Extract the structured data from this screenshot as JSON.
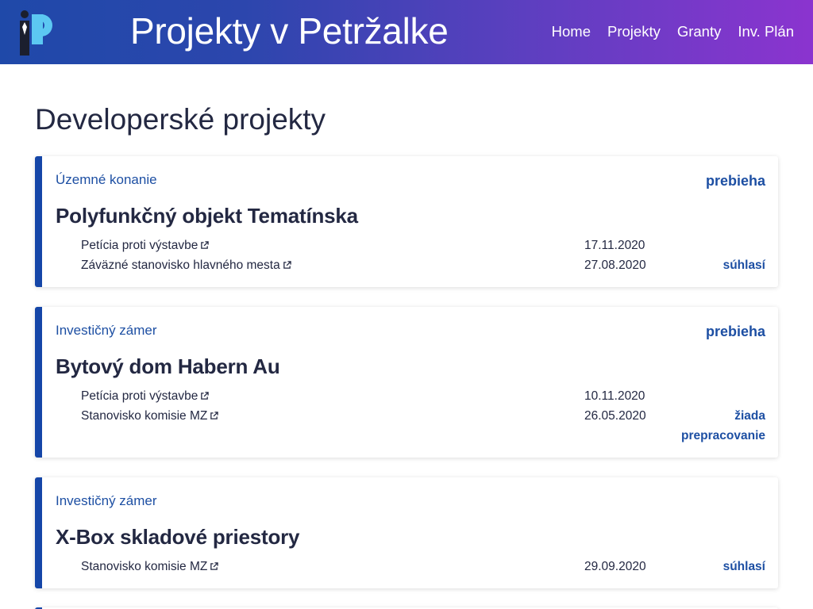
{
  "header": {
    "title": "Projekty v Petržalke",
    "nav": [
      "Home",
      "Projekty",
      "Granty",
      "Inv. Plán"
    ]
  },
  "page_title": "Developerské projekty",
  "colors": {
    "accent": "#1d4fa3",
    "card_border": "#1546a8",
    "header_start": "#1f49a9",
    "header_end": "#8b34cf"
  },
  "projects": [
    {
      "category": "Územné konanie",
      "state": "prebieha",
      "name": "Polyfunkčný objekt Tematínska",
      "docs": [
        {
          "label": "Petícia proti výstavbe",
          "date": "17.11.2020",
          "verdict": ""
        },
        {
          "label": "Záväzné stanovisko hlavného mesta",
          "date": "27.08.2020",
          "verdict": "súhlasí"
        }
      ]
    },
    {
      "category": "Investičný zámer",
      "state": "prebieha",
      "name": "Bytový dom Habern Au",
      "docs": [
        {
          "label": "Petícia proti výstavbe",
          "date": "10.11.2020",
          "verdict": ""
        },
        {
          "label": "Stanovisko komisie MZ",
          "date": "26.05.2020",
          "verdict": "žiada prepracovanie"
        }
      ]
    },
    {
      "category": "Investičný zámer",
      "state": "",
      "name": "X-Box skladové priestory",
      "docs": [
        {
          "label": "Stanovisko komisie MZ",
          "date": "29.09.2020",
          "verdict": "súhlasí"
        }
      ]
    }
  ]
}
